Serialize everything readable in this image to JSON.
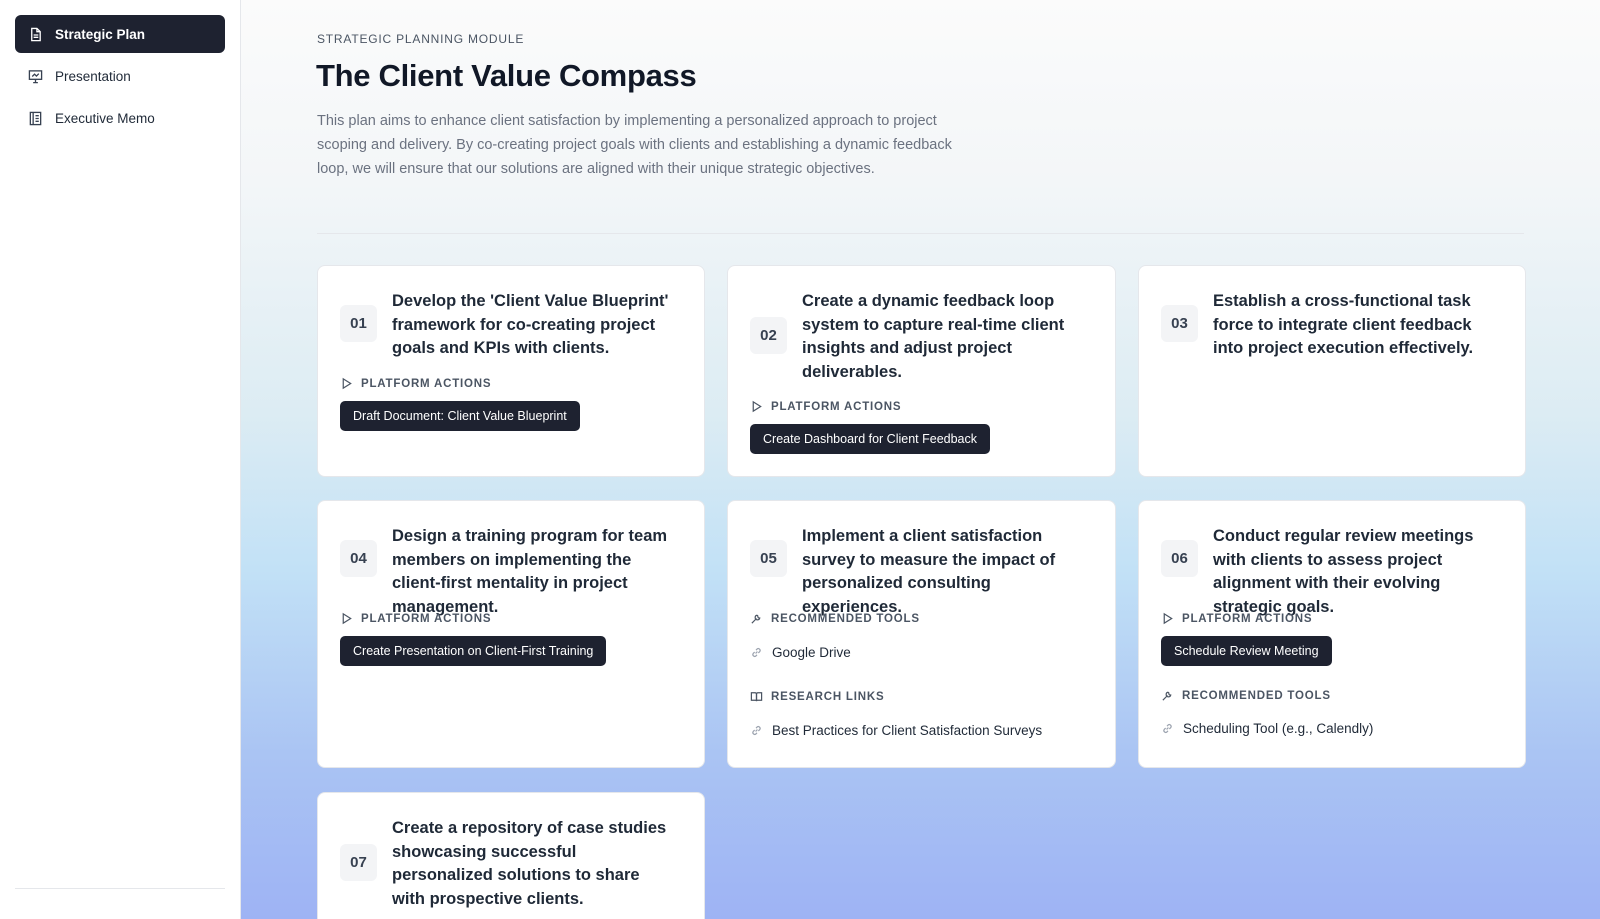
{
  "sidebar": {
    "items": [
      {
        "label": "Strategic Plan",
        "icon": "document-icon",
        "active": true
      },
      {
        "label": "Presentation",
        "icon": "presentation-icon",
        "active": false
      },
      {
        "label": "Executive Memo",
        "icon": "memo-icon",
        "active": false
      }
    ]
  },
  "header": {
    "eyebrow": "STRATEGIC PLANNING MODULE",
    "title": "The Client Value Compass",
    "description": "This plan aims to enhance client satisfaction by implementing a personalized approach to project scoping and delivery. By co-creating project goals with clients and establishing a dynamic feedback loop, we will ensure that our solutions are aligned with their unique strategic objectives."
  },
  "labels": {
    "platform_actions": "PLATFORM ACTIONS",
    "recommended_tools": "RECOMMENDED TOOLS",
    "research_links": "RESEARCH LINKS"
  },
  "cards": [
    {
      "number": "01",
      "title": "Develop the 'Client Value Blueprint' framework for co-creating project goals and KPIs with clients.",
      "action": "Draft Document: Client Value Blueprint"
    },
    {
      "number": "02",
      "title": "Create a dynamic feedback loop system to capture real-time client insights and adjust project deliverables.",
      "action": "Create Dashboard for Client Feedback"
    },
    {
      "number": "03",
      "title": "Establish a cross-functional task force to integrate client feedback into project execution effectively."
    },
    {
      "number": "04",
      "title": "Design a training program for team members on implementing the client-first mentality in project management.",
      "action": "Create Presentation on Client-First Training"
    },
    {
      "number": "05",
      "title": "Implement a client satisfaction survey to measure the impact of personalized consulting experiences.",
      "tools": [
        "Google Drive"
      ],
      "research": [
        "Best Practices for Client Satisfaction Surveys"
      ]
    },
    {
      "number": "06",
      "title": "Conduct regular review meetings with clients to assess project alignment with their evolving strategic goals.",
      "action": "Schedule Review Meeting",
      "tools": [
        "Scheduling Tool (e.g., Calendly)"
      ]
    },
    {
      "number": "07",
      "title": "Create a repository of case studies showcasing successful personalized solutions to share with prospective clients."
    }
  ],
  "colors": {
    "accent_dark": "#1e2230",
    "gradient_bottom": "#9eb3f4"
  }
}
